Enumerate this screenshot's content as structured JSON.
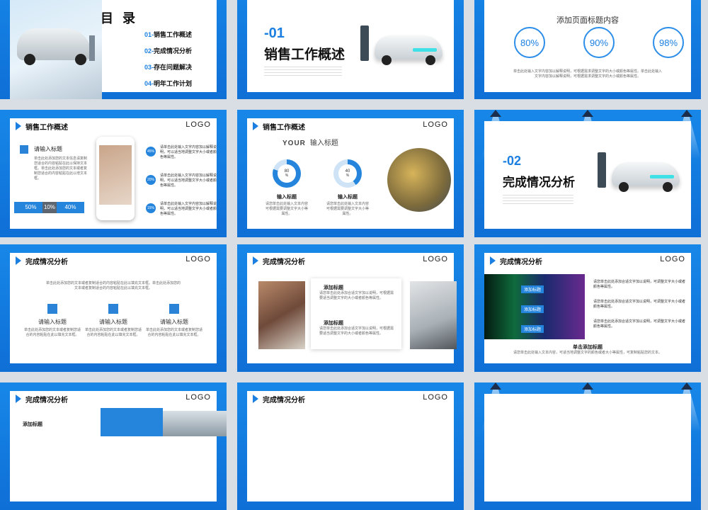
{
  "logo": "LOGO",
  "toc": {
    "title": "目 录",
    "items": [
      {
        "num": "01-",
        "label": "销售工作概述"
      },
      {
        "num": "02-",
        "label": "完成情况分析"
      },
      {
        "num": "03-",
        "label": "存在问题解决"
      },
      {
        "num": "04-",
        "label": "明年工作计划"
      }
    ]
  },
  "section1": {
    "num": "-01",
    "title": "销售工作概述"
  },
  "section2": {
    "num": "-02",
    "title": "完成情况分析"
  },
  "percent_slide": {
    "title": "添加页面标题内容",
    "rings": [
      "80%",
      "90%",
      "98%"
    ],
    "desc": "单击此处输入文字内容加以解释说明，可根据需求调整文字的大小或颜色等属性。单击此处输入文字内容加以解释说明，可根据需求调整文字的大小或颜色等属性。"
  },
  "s4": {
    "header": "销售工作概述",
    "title": "请输入标题",
    "body": "单击此处添加您的文本信息请复制您适合的内容粘贴在此以保持文本框。单击此处添加您的文本或者复制您适合的内容粘贴在此以增文本框。",
    "bars": [
      "50%",
      "10%",
      "40%"
    ],
    "bullets": [
      {
        "pct": "45%",
        "text": "请单击此处输入文字内容加以解释说明，可以适当地调整文字大小或者颜色等属性。"
      },
      {
        "pct": "20%",
        "text": "请单击此处输入文字内容加以解释说明，可以适当地调整文字大小或者颜色等属性。"
      },
      {
        "pct": "15%",
        "text": "请单击此处输入文字内容加以解释说明，可以适当地调整文字大小或者颜色等属性。"
      }
    ]
  },
  "s5": {
    "header": "销售工作概述",
    "title_en": "YOUR",
    "title_cn": "输入标题",
    "rings": [
      {
        "value": "80",
        "unit": "%",
        "label": "输入标题",
        "desc": "请您单击此处输入文本内容可根据需要调整文字大小等属性。"
      },
      {
        "value": "40",
        "unit": "%",
        "label": "输入标题",
        "desc": "请您单击此处输入文本内容可根据需要调整文字大小等属性。"
      }
    ]
  },
  "s7": {
    "header": "完成情况分析",
    "intro": "单击此处添加您的文本或者复制适合的内容粘贴在此以填充文本框。单击此处添加您的文本或者复制适合的内容粘贴在此以填充文本框。",
    "cols": [
      {
        "title": "请输入标题",
        "desc": "单击此处添加您的文本或者复制您适合的内容粘贴在此以填充文本框。"
      },
      {
        "title": "请输入标题",
        "desc": "单击此处添加您的文本或者复制您适合的内容粘贴在此以填充文本框。"
      },
      {
        "title": "请输入标题",
        "desc": "单击此处添加您的文本或者复制您适合的内容粘贴在此以填充文本框。"
      }
    ]
  },
  "s8": {
    "header": "完成情况分析",
    "items": [
      {
        "title": "添加标题",
        "desc": "请您单击此处添加合适文字加以说明，可根据需要适当调整文字的大小或者颜色等属性。"
      },
      {
        "title": "添加标题",
        "desc": "请您单击此处添加合适文字加以说明，可根据需要适当调整文字的大小或者颜色等属性。"
      }
    ]
  },
  "s9": {
    "header": "完成情况分析",
    "tags": [
      "添加标题",
      "添加标题",
      "添加标题"
    ],
    "side": [
      "请您单击此处添加合适文字加以说明，可调整文字大小或者颜色等属性。",
      "请您单击此处添加合适文字加以说明，可调整文字大小或者颜色等属性。",
      "请您单击此处添加合适文字加以说明，可调整文字大小或者颜色等属性。"
    ],
    "bottom_title": "单击添加标题",
    "bottom_desc": "请您单击此处输入文本内容，可适当地调整文字的颜色或者大小等属性，可复制粘贴您的文本。"
  },
  "s10": {
    "header": "完成情况分析",
    "sub": "添加标题"
  },
  "s11": {
    "header": "完成情况分析"
  },
  "colors": {
    "primary": "#1a7fe0",
    "dark": "#0b3c84",
    "light": "#4aa9ff"
  }
}
